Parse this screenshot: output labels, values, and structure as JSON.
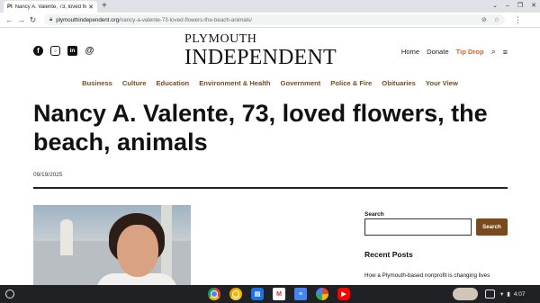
{
  "browser": {
    "tab_title": "Nancy A. Valente, 73, loved flo",
    "tab_favicon": "PI",
    "url_host": "plymouthindependent.org",
    "url_path": "/nancy-a-valente-73-loved-flowers-the-beach-animals/",
    "icons": [
      "back-icon",
      "forward-icon",
      "reload-icon",
      "lock-icon",
      "eye-off-icon",
      "star-icon",
      "menu-icon"
    ]
  },
  "site": {
    "logo_line1": "PLYMOUTH",
    "logo_line2": "INDEPENDENT",
    "social_icons": [
      "facebook-icon",
      "instagram-icon",
      "linkedin-icon",
      "threads-icon"
    ],
    "topnav": {
      "home": "Home",
      "donate": "Donate",
      "tip": "Tip Drop"
    },
    "categories": [
      "Business",
      "Culture",
      "Education",
      "Environment & Health",
      "Government",
      "Police & Fire",
      "Obituaries",
      "Your View"
    ],
    "colors": {
      "category": "#7a4a1c",
      "tip": "#d8622c",
      "button": "#7a4a1c"
    }
  },
  "article": {
    "headline": "Nancy A. Valente, 73, loved flowers, the beach, animals",
    "date": "09/19/2025"
  },
  "sidebar": {
    "search_label": "Search",
    "search_button": "Search",
    "search_value": "",
    "recent_title": "Recent Posts",
    "recent_items": [
      "How a Plymouth-based nonprofit is changing lives"
    ]
  },
  "shelf": {
    "apps": [
      "chrome-icon",
      "chrome-canary-icon",
      "files-icon",
      "gmail-icon",
      "docs-icon",
      "photos-icon",
      "youtube-icon"
    ],
    "time": "4:07"
  }
}
